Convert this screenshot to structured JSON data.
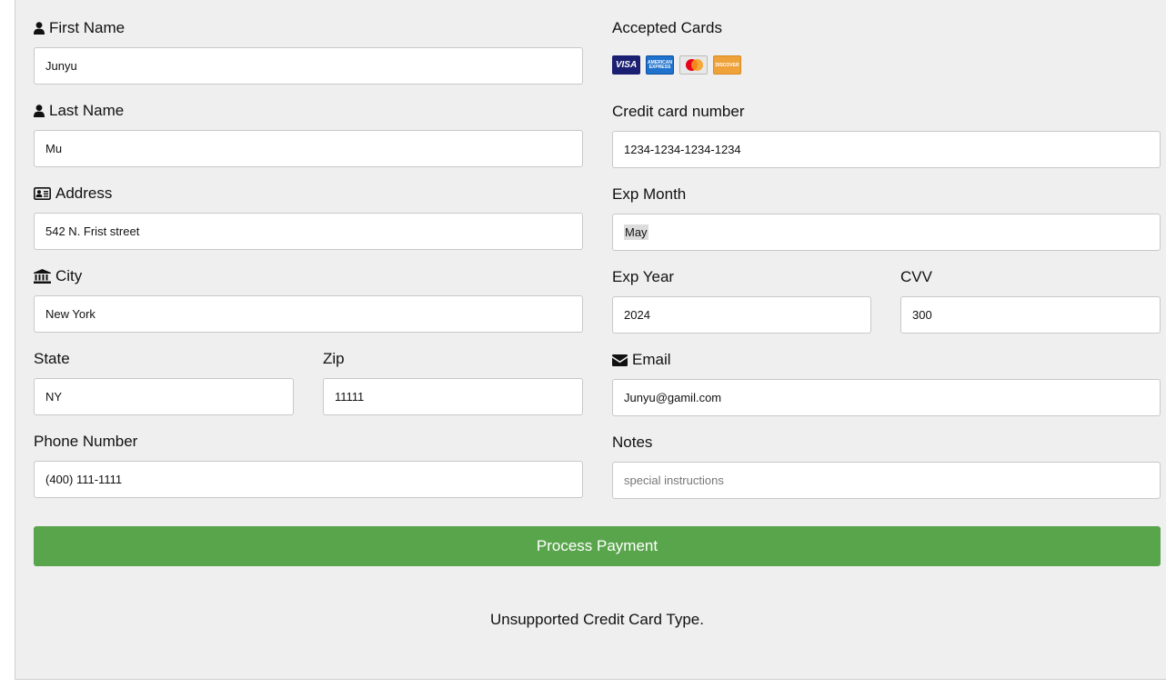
{
  "billing": {
    "first_name": {
      "label": "First Name",
      "value": "Junyu"
    },
    "last_name": {
      "label": "Last Name",
      "value": "Mu"
    },
    "address": {
      "label": "Address",
      "value": "542 N. Frist street"
    },
    "city": {
      "label": "City",
      "value": "New York"
    },
    "state": {
      "label": "State",
      "value": "NY"
    },
    "zip": {
      "label": "Zip",
      "value": "11111"
    },
    "phone": {
      "label": "Phone Number",
      "value": "(400) 111-1111"
    }
  },
  "payment": {
    "accepted_cards": {
      "label": "Accepted Cards",
      "cards": [
        {
          "name": "visa-icon",
          "text": "VISA"
        },
        {
          "name": "amex-icon",
          "text": "AMERICAN EXPRESS"
        },
        {
          "name": "mastercard-icon",
          "text": ""
        },
        {
          "name": "discover-icon",
          "text": "DISCOVER"
        }
      ]
    },
    "card_number": {
      "label": "Credit card number",
      "value": "1234-1234-1234-1234"
    },
    "exp_month": {
      "label": "Exp Month",
      "value": "May"
    },
    "exp_year": {
      "label": "Exp Year",
      "value": "2024"
    },
    "cvv": {
      "label": "CVV",
      "value": "300"
    },
    "email": {
      "label": "Email",
      "value": "Junyu@gamil.com"
    },
    "notes": {
      "label": "Notes",
      "value": "",
      "placeholder": "special instructions"
    }
  },
  "submit_label": "Process Payment",
  "status_message": "Unsupported Credit Card Type.",
  "colors": {
    "button": "#59a54c",
    "panel": "#efefef"
  }
}
